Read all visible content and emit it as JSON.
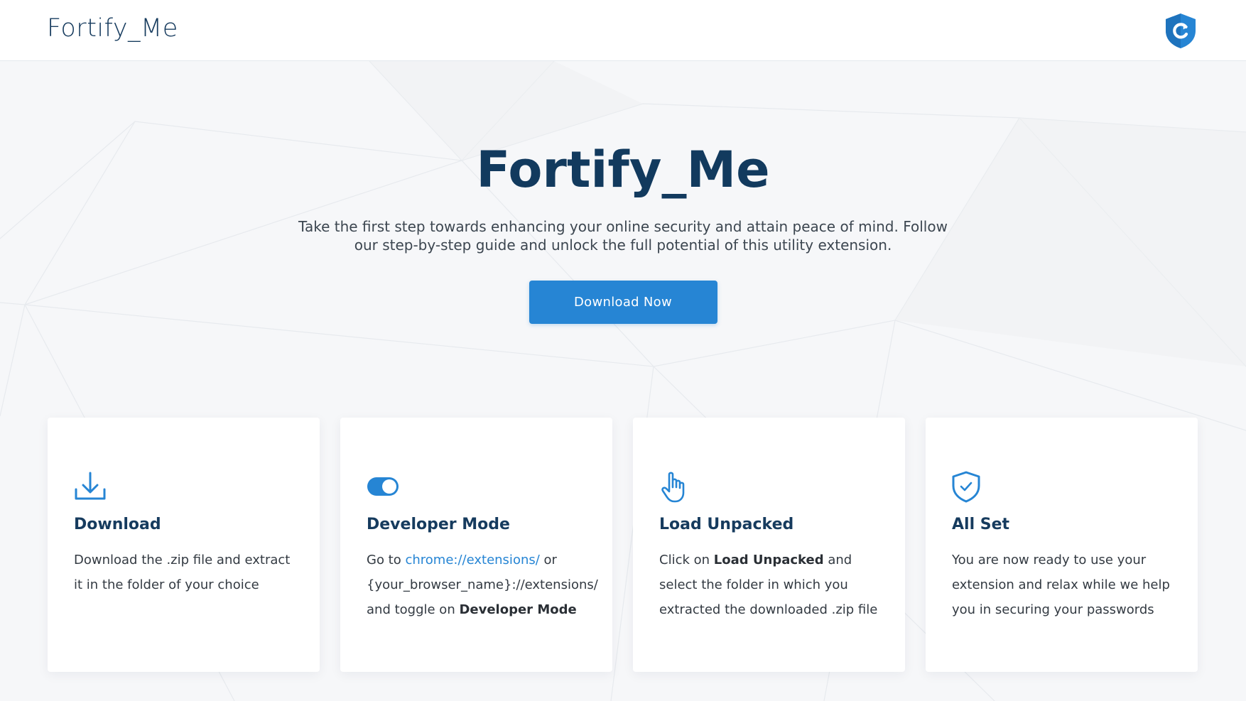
{
  "header": {
    "brand": "Fortify_Me",
    "logo_icon": "shield-refresh-icon"
  },
  "hero": {
    "title": "Fortify_Me",
    "description": "Take the first step towards enhancing your online security and attain peace of mind. Follow our step-by-step guide and unlock the full potential of this utility extension.",
    "cta_label": "Download Now"
  },
  "steps": [
    {
      "icon": "download-icon",
      "title": "Download",
      "text": "Download the .zip file and extract it in the folder of your choice"
    },
    {
      "icon": "toggle-icon",
      "title": "Developer Mode",
      "text_prefix": "Go to ",
      "link": "chrome://extensions/",
      "text_mid": " or {your_browser_name}://extensions/ and toggle on ",
      "text_bold": "Developer Mode"
    },
    {
      "icon": "pointer-hand-icon",
      "title": "Load Unpacked",
      "text_prefix": "Click on ",
      "text_bold": "Load Unpacked",
      "text_suffix": " and select the folder in which you extracted the downloaded .zip file"
    },
    {
      "icon": "shield-check-icon",
      "title": "All Set",
      "text": "You are now ready to use your extension and relax while we help you in securing your passwords"
    }
  ],
  "colors": {
    "primary": "#2685d4",
    "heading": "#123a5e",
    "background": "#f6f7f9"
  }
}
